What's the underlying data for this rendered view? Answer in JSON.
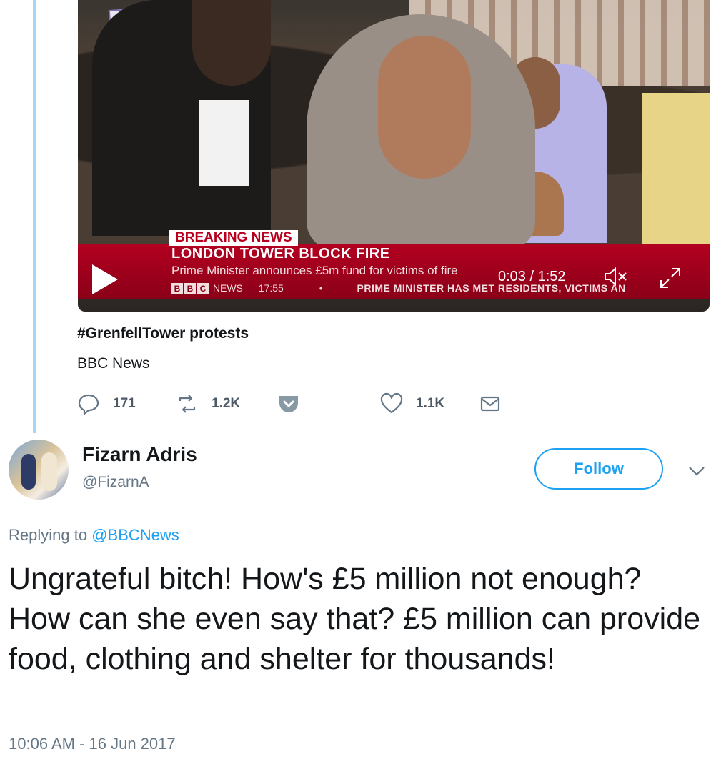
{
  "video": {
    "breaking_tag": "BREAKING NEWS",
    "headline": "LONDON TOWER BLOCK FIRE",
    "subheadline": "Prime Minister announces £5m fund for victims of fire",
    "bbc_letters": [
      "B",
      "B",
      "C"
    ],
    "ticker_brand": "NEWS",
    "ticker_time": "17:55",
    "ticker_bullet": "•",
    "ticker_text": "PRIME MINISTER HAS MET RESIDENTS, VICTIMS AN",
    "playback_time": "0:03 / 1:52",
    "icons": {
      "play": "play-icon",
      "mute": "mute-icon",
      "expand": "expand-icon"
    }
  },
  "card": {
    "title": "#GrenfellTower protests",
    "source": "BBC News"
  },
  "actions": {
    "reply_count": "171",
    "retweet_count": "1.2K",
    "like_count": "1.1K"
  },
  "tweet": {
    "name": "Fizarn Adris",
    "handle": "@FizarnA",
    "follow_label": "Follow",
    "replying_prefix": "Replying to",
    "replying_to": "@BBCNews",
    "text": "Ungrateful bitch! How's £5 million not enough? How can she even say that? £5 million can provide food, clothing and shelter for thousands!",
    "timestamp": "10:06 AM - 16 Jun 2017"
  },
  "colors": {
    "accent": "#1da1f2",
    "thread_line": "#a9d4f3",
    "muted_text": "#657786",
    "bbc_red": "#b30020"
  }
}
